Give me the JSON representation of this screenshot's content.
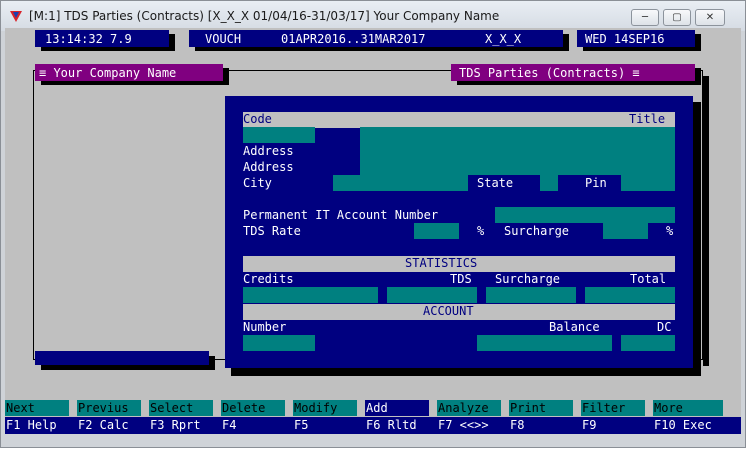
{
  "window": {
    "title": "[M:1]  TDS Parties (Contracts)  [X_X_X  01/04/16-31/03/17]  Your Company Name",
    "minimize_icon": "minimize-icon",
    "maximize_icon": "maximize-icon",
    "close_icon": "close-icon"
  },
  "statusbar": {
    "time": "13:14:32 7.9",
    "mode": "VOUCH",
    "period": "01APR2016..31MAR2017",
    "code": "X_X_X",
    "date": "WED 14SEP16"
  },
  "panels": {
    "company": "≡ Your Company Name",
    "module": "TDS Parties (Contracts) ≡"
  },
  "form": {
    "code_label": "Code",
    "title_label": "Title",
    "address1_label": "Address",
    "address2_label": "Address",
    "city_label": "City",
    "state_label": "State",
    "pin_label": "Pin",
    "pan_label": "Permanent IT Account Number",
    "tds_rate_label": "TDS Rate",
    "percent1": "%",
    "surcharge_label": "Surcharge",
    "percent2": "%",
    "statistics_header": "STATISTICS",
    "credits_label": "Credits",
    "tds_label": "TDS",
    "stat_surcharge_label": "Surcharge",
    "total_label": "Total",
    "account_header": "ACCOUNT",
    "number_label": "Number",
    "balance_label": "Balance",
    "dc_label": "DC"
  },
  "fkeys": [
    {
      "top": "Next",
      "bottom": "F1 Help"
    },
    {
      "top": "Previus",
      "bottom": "F2 Calc"
    },
    {
      "top": "Select",
      "bottom": "F3 Rprt"
    },
    {
      "top": "Delete",
      "bottom": "F4"
    },
    {
      "top": "Modify",
      "bottom": "F5"
    },
    {
      "top": "Add",
      "bottom": "F6 Rltd"
    },
    {
      "top": "Analyze",
      "bottom": "F7 <<>>"
    },
    {
      "top": "Print",
      "bottom": "F8"
    },
    {
      "top": "Filter",
      "bottom": "F9"
    },
    {
      "top": "More",
      "bottom": "F10 Exec"
    }
  ],
  "colors": {
    "dos_blue": "#000080",
    "dos_teal": "#008080",
    "dos_purple": "#800080",
    "dos_gray": "#c0c0c0"
  }
}
